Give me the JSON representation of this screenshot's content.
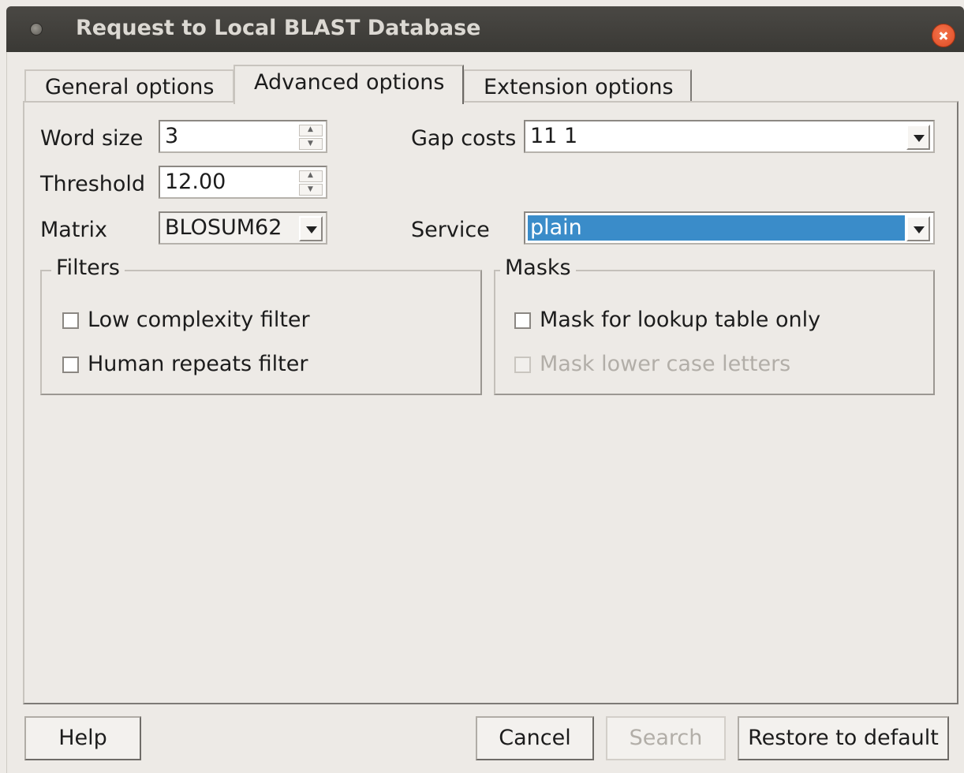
{
  "window": {
    "title": "Request to Local BLAST Database"
  },
  "tabs": [
    {
      "label": "General options",
      "active": false
    },
    {
      "label": "Advanced options",
      "active": true
    },
    {
      "label": "Extension options",
      "active": false
    }
  ],
  "advanced": {
    "word_size": {
      "label": "Word size",
      "value": "3"
    },
    "threshold": {
      "label": "Threshold",
      "value": "12.00"
    },
    "matrix": {
      "label": "Matrix",
      "value": "BLOSUM62"
    },
    "gap_costs": {
      "label": "Gap costs",
      "value": "11 1"
    },
    "service": {
      "label": "Service",
      "value": "plain"
    }
  },
  "filters": {
    "title": "Filters",
    "low_complexity": {
      "label": "Low complexity filter",
      "checked": false
    },
    "human_repeats": {
      "label": "Human repeats filter",
      "checked": false
    }
  },
  "masks": {
    "title": "Masks",
    "lookup_table": {
      "label": "Mask for lookup table only",
      "checked": false
    },
    "lower_case": {
      "label": "Mask lower case letters",
      "checked": false,
      "enabled": false
    }
  },
  "buttons": {
    "help": "Help",
    "cancel": "Cancel",
    "search": "Search",
    "restore": "Restore to default"
  },
  "colors": {
    "titlebar": "#3c3b37",
    "close": "#e95420",
    "selection": "#3a8cc9"
  }
}
